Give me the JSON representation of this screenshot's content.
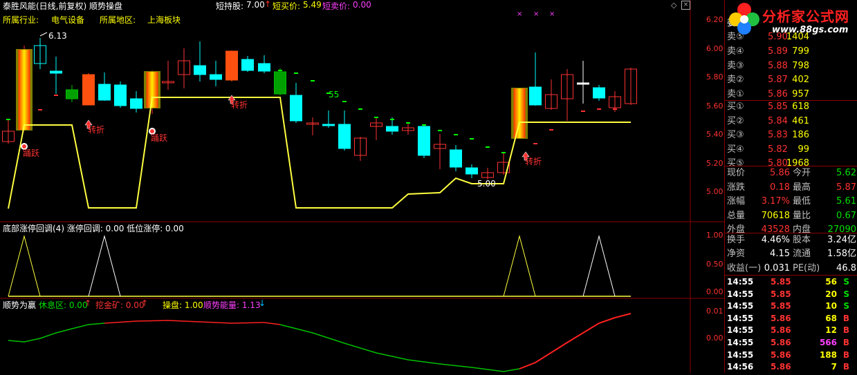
{
  "header": {
    "title": "泰胜风能(日线,前复权) 顺势操盘",
    "short_hold_label": "短持股:",
    "short_hold_value": "7.00",
    "short_buy_label": "短买价:",
    "short_buy_value": "5.49",
    "short_sell_label": "短卖价:",
    "short_sell_value": "0.00",
    "industry_label": "所属行业:",
    "industry_value": "电气设备",
    "region_label": "所属地区:",
    "region_value": "上海板块"
  },
  "main_chart": {
    "price_axis": [
      "6.20",
      "6.00",
      "5.80",
      "5.60",
      "5.40",
      "5.20",
      "5.00"
    ],
    "annotations": {
      "high_label": "6.13",
      "low_label": "5.00",
      "cycle_label": "55",
      "turn_label": "转折",
      "jump_label": "踊跃"
    }
  },
  "panel2": {
    "title": "底部涨停回调(4) 涨停回调: 0.00 低位涨停: 0.00",
    "axis": [
      "1.00",
      "0.50",
      "0.00"
    ]
  },
  "panel3": {
    "title": "顺势为赢",
    "rest_label": "休息区: 0.00",
    "dig_label": "挖金矿: 0.00",
    "trade_label": "操盘: 1.00",
    "energy_label": "顺势能量: 1.13",
    "axis": [
      "0.01",
      "0.00"
    ]
  },
  "logo": {
    "text": "分析家公式网",
    "url": "www.88gs.com"
  },
  "quote": {
    "weibi_label": "委比",
    "sells": [
      {
        "label": "卖⑤",
        "price": "5.90",
        "vol": "1404"
      },
      {
        "label": "卖④",
        "price": "5.89",
        "vol": "799"
      },
      {
        "label": "卖③",
        "price": "5.88",
        "vol": "798"
      },
      {
        "label": "卖②",
        "price": "5.87",
        "vol": "402"
      },
      {
        "label": "卖①",
        "price": "5.86",
        "vol": "957"
      }
    ],
    "buys": [
      {
        "label": "买①",
        "price": "5.85",
        "vol": "618"
      },
      {
        "label": "买②",
        "price": "5.84",
        "vol": "461"
      },
      {
        "label": "买③",
        "price": "5.83",
        "vol": "186"
      },
      {
        "label": "买④",
        "price": "5.82",
        "vol": "99"
      },
      {
        "label": "买⑤",
        "price": "5.80",
        "vol": "1968"
      }
    ],
    "stats": [
      {
        "l1": "现价",
        "v1": "5.86",
        "c1": "#ff3232",
        "l2": "今开",
        "v2": "5.62",
        "c2": "#00e000"
      },
      {
        "l1": "涨跌",
        "v1": "0.18",
        "c1": "#ff3232",
        "l2": "最高",
        "v2": "5.87",
        "c2": "#ff3232"
      },
      {
        "l1": "涨幅",
        "v1": "3.17%",
        "c1": "#ff3232",
        "l2": "最低",
        "v2": "5.61",
        "c2": "#00e000"
      },
      {
        "l1": "总量",
        "v1": "70618",
        "c1": "#ffff00",
        "l2": "量比",
        "v2": "0.67",
        "c2": "#00e000"
      },
      {
        "l1": "外盘",
        "v1": "43528",
        "c1": "#ff3232",
        "l2": "内盘",
        "v2": "27090",
        "c2": "#00e000"
      }
    ],
    "stats2": [
      {
        "l1": "换手",
        "v1": "4.46%",
        "l2": "股本",
        "v2": "3.24亿"
      },
      {
        "l1": "净资",
        "v1": "4.15",
        "l2": "流通",
        "v2": "1.58亿"
      },
      {
        "l1": "收益(一)",
        "v1": "0.031",
        "l2": "PE(动)",
        "v2": "46.8"
      }
    ],
    "ticks": [
      {
        "time": "14:55",
        "price": "5.85",
        "vol": "56",
        "side": "S"
      },
      {
        "time": "14:55",
        "price": "5.85",
        "vol": "20",
        "side": "S"
      },
      {
        "time": "14:55",
        "price": "5.85",
        "vol": "10",
        "side": "S"
      },
      {
        "time": "14:55",
        "price": "5.86",
        "vol": "68",
        "side": "B"
      },
      {
        "time": "14:55",
        "price": "5.86",
        "vol": "12",
        "side": "B"
      },
      {
        "time": "14:55",
        "price": "5.86",
        "vol": "566",
        "side": "B"
      },
      {
        "time": "14:55",
        "price": "5.86",
        "vol": "188",
        "side": "B"
      },
      {
        "time": "14:56",
        "price": "5.86",
        "vol": "7",
        "side": "B"
      }
    ]
  }
}
